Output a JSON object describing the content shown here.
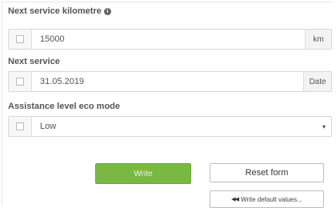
{
  "fields": {
    "next_service_km": {
      "label": "Next service kilometre",
      "info_icon": "info-icon",
      "value": "15000",
      "unit": "km"
    },
    "next_service": {
      "label": "Next service",
      "value": "31.05.2019",
      "unit": "Date"
    },
    "assistance_eco": {
      "label": "Assistance level eco mode",
      "value": "Low",
      "caret": "▾"
    }
  },
  "actions": {
    "write_label": "Write",
    "reset_label": "Reset form",
    "write_default_icon": "skip-back-icon",
    "write_default_label": "Write default values..."
  },
  "colors": {
    "write_button": "#7ab844"
  }
}
